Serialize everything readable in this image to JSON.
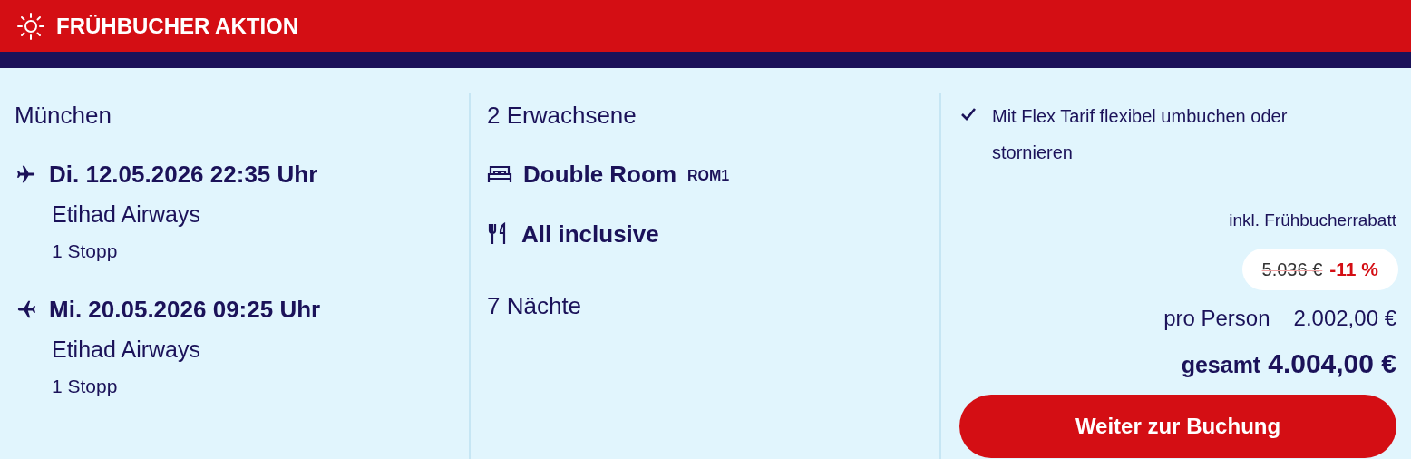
{
  "banner": {
    "title": "FRÜHBUCHER AKTION"
  },
  "departure_city": "München",
  "flights": [
    {
      "kind": "outbound",
      "datetime": "Di. 12.05.2026 22:35 Uhr",
      "airline": "Etihad Airways",
      "stops": "1 Stopp"
    },
    {
      "kind": "return",
      "datetime": "Mi. 20.05.2026 09:25 Uhr",
      "airline": "Etihad Airways",
      "stops": "1 Stopp"
    }
  ],
  "travellers": "2 Erwachsene",
  "accommodation": [
    {
      "kind": "room",
      "label": "Double Room",
      "code": "ROM1"
    },
    {
      "kind": "board",
      "label": "All inclusive"
    }
  ],
  "nights": "7 Nächte",
  "features": [
    {
      "label": "Mit Flex Tarif flexibel umbuchen oder stornieren",
      "checked": true
    }
  ],
  "price": {
    "note": "inkl. Frühbucherrabatt",
    "old_price": "5.036 €",
    "discount": "-11 %",
    "per_person_label": "pro Person",
    "per_person": "2.002,00 €",
    "total_label": "gesamt",
    "total": "4.004,00 €"
  },
  "cta": "Weiter zur Buchung"
}
